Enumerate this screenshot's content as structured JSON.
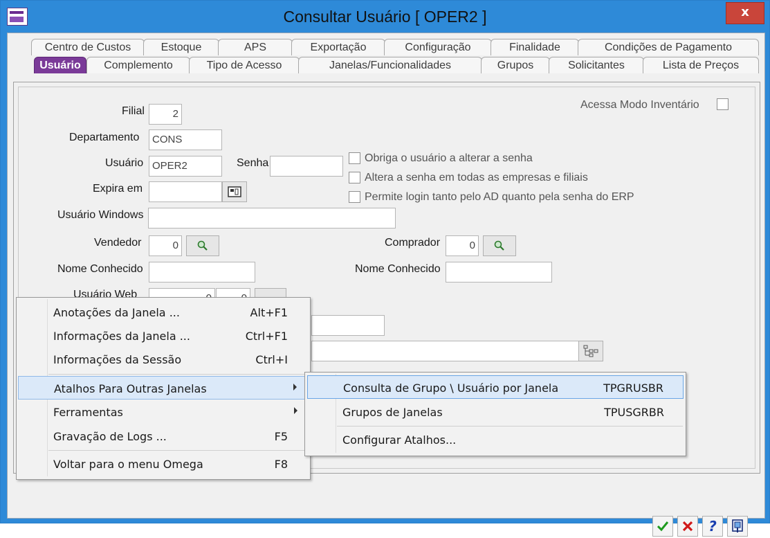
{
  "window": {
    "title": "Consultar Usuário [ OPER2 ]",
    "close_label": "x"
  },
  "tabs_row1": [
    {
      "label": "Centro de Custos"
    },
    {
      "label": "Estoque"
    },
    {
      "label": "APS"
    },
    {
      "label": "Exportação"
    },
    {
      "label": "Configuração"
    },
    {
      "label": "Finalidade"
    },
    {
      "label": "Condições de Pagamento"
    }
  ],
  "tabs_row2": [
    {
      "label": "Usuário",
      "active": true
    },
    {
      "label": "Complemento"
    },
    {
      "label": "Tipo de Acesso"
    },
    {
      "label": "Janelas/Funcionalidades"
    },
    {
      "label": "Grupos"
    },
    {
      "label": "Solicitantes"
    },
    {
      "label": "Lista de Preços"
    }
  ],
  "form": {
    "acessa_modo_inventario": {
      "label": "Acessa Modo Inventário",
      "checked": false
    },
    "filial": {
      "label": "Filial",
      "value": "2"
    },
    "departamento": {
      "label": "Departamento",
      "value": "CONS"
    },
    "usuario": {
      "label": "Usuário",
      "value": "OPER2"
    },
    "senha": {
      "label": "Senha",
      "value": ""
    },
    "expira_em": {
      "label": "Expira em",
      "value": ""
    },
    "usuario_windows": {
      "label": "Usuário Windows",
      "value": ""
    },
    "vendedor": {
      "label": "Vendedor",
      "value": "0"
    },
    "comprador": {
      "label": "Comprador",
      "value": "0"
    },
    "nome_conhecido_vend": {
      "label": "Nome Conhecido",
      "value": ""
    },
    "nome_conhecido_comp": {
      "label": "Nome Conhecido",
      "value": ""
    },
    "usuario_web": {
      "label": "Usuário Web",
      "value1": "0",
      "value2": "0"
    },
    "checkboxes": [
      {
        "label": "Obriga o usuário a alterar a senha",
        "checked": false
      },
      {
        "label": "Altera a senha em todas as empresas e filiais",
        "checked": false
      },
      {
        "label": "Permite login tanto pelo AD quanto pela senha do ERP",
        "checked": false
      }
    ]
  },
  "context_menu": {
    "items": [
      {
        "label": "Anotações da Janela ...",
        "shortcut": "Alt+F1"
      },
      {
        "label": "Informações da Janela ...",
        "shortcut": "Ctrl+F1"
      },
      {
        "label": "Informações da Sessão",
        "shortcut": "Ctrl+I"
      },
      {
        "label": "Atalhos Para Outras Janelas",
        "shortcut": "",
        "submenu": true,
        "highlighted": true
      },
      {
        "label": "Ferramentas",
        "shortcut": "",
        "submenu": true
      },
      {
        "label": "Gravação de Logs ...",
        "shortcut": "F5"
      },
      {
        "label": "Voltar para o menu Omega",
        "shortcut": "F8"
      }
    ]
  },
  "submenu": {
    "items": [
      {
        "label": "Consulta de Grupo \\ Usuário por Janela",
        "shortcut": "TPGRUSBR",
        "highlighted": true
      },
      {
        "label": "Grupos de Janelas",
        "shortcut": "TPUSGRBR"
      },
      {
        "label": "Configurar Atalhos...",
        "shortcut": ""
      }
    ]
  },
  "footer": {
    "ok_icon": "check-icon",
    "cancel_icon": "x-icon",
    "help_label": "?",
    "exit_icon": "exit-door-icon",
    "colors": {
      "ok": "#1e9a1e",
      "cancel": "#d01818",
      "help": "#1a3fb0"
    }
  }
}
